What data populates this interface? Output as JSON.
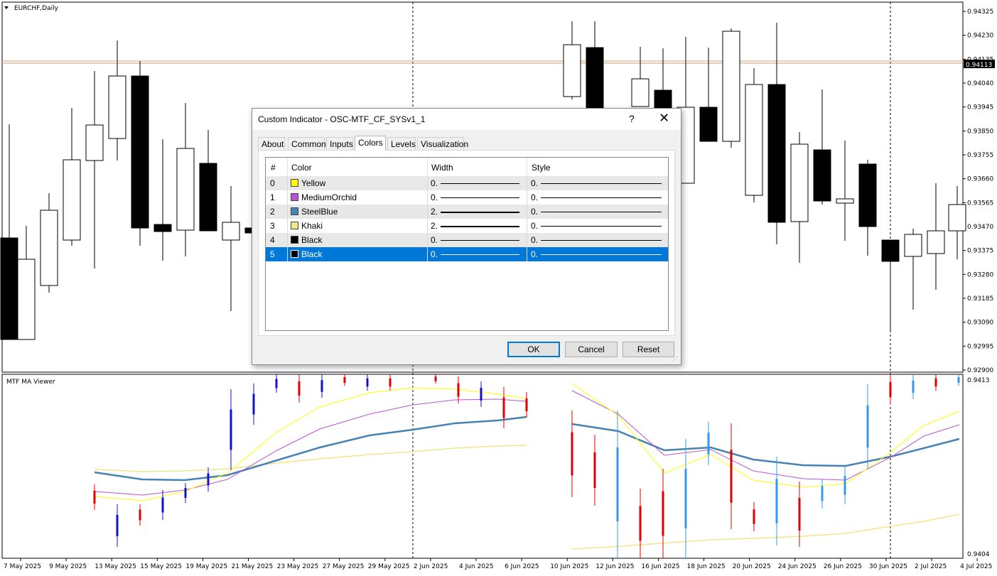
{
  "chart": {
    "symbol_label": "EURCHF,Daily",
    "subwindow_label": "MTF MA Viewer",
    "price_axis_ticks": [
      "0.94325",
      "0.94230",
      "0.94135",
      "0.94040",
      "0.93945",
      "0.93850",
      "0.93755",
      "0.93660",
      "0.93565",
      "0.93470",
      "0.93375",
      "0.93280",
      "0.93185",
      "0.93090",
      "0.92995",
      "0.92900"
    ],
    "current_price": "0.94113",
    "sub_axis_top": "0.9413",
    "sub_axis_bottom": "0.9404",
    "date_labels": [
      "7 May 2025",
      "9 May 2025",
      "13 May 2025",
      "15 May 2025",
      "19 May 2025",
      "21 May 2025",
      "23 May 2025",
      "27 May 2025",
      "29 May 2025",
      "2 Jun 2025",
      "4 Jun 2025",
      "6 Jun 2025",
      "10 Jun 2025",
      "12 Jun 2025",
      "16 Jun 2025",
      "18 Jun 2025",
      "20 Jun 2025",
      "24 Jun 2025",
      "26 Jun 2025",
      "30 Jun 2025",
      "2 Jul 2025",
      "4 Jul 2025"
    ],
    "colors": {
      "grid_line": "#000000",
      "price_line": "#e8a060",
      "current_price_bg": "#000000",
      "sub_yellow": "#ffff00",
      "sub_orchid": "#ba55d3",
      "sub_steelblue": "#4682b4",
      "sub_khaki": "#f0e68c",
      "bar_red": "#e00000",
      "bar_blue_dark": "#1010d0",
      "bar_blue_light": "#3399ee"
    }
  },
  "dialog": {
    "title": "Custom Indicator - OSC-MTF_CF_SYSv1_1",
    "help_label": "?",
    "close_label": "✕",
    "tabs": [
      "About",
      "Common",
      "Inputs",
      "Colors",
      "Levels",
      "Visualization"
    ],
    "active_tab": "Colors",
    "columns": {
      "index": "#",
      "color": "Color",
      "width": "Width",
      "style": "Style"
    },
    "rows": [
      {
        "index": "0",
        "color_name": "Yellow",
        "swatch": "#ffff00",
        "width": "0.",
        "style": "0."
      },
      {
        "index": "1",
        "color_name": "MediumOrchid",
        "swatch": "#ba55d3",
        "width": "0.",
        "style": "0."
      },
      {
        "index": "2",
        "color_name": "SteelBlue",
        "swatch": "#4682b4",
        "width": "2.",
        "style": "0."
      },
      {
        "index": "3",
        "color_name": "Khaki",
        "swatch": "#f0e68c",
        "width": "2.",
        "style": "0."
      },
      {
        "index": "4",
        "color_name": "Black",
        "swatch": "#000000",
        "width": "0.",
        "style": "0."
      },
      {
        "index": "5",
        "color_name": "Black",
        "swatch": "#000000",
        "width": "0.",
        "style": "0."
      }
    ],
    "selected_row": 5,
    "selection_color": "#0078d7",
    "buttons": {
      "ok": "OK",
      "cancel": "Cancel",
      "reset": "Reset"
    }
  }
}
